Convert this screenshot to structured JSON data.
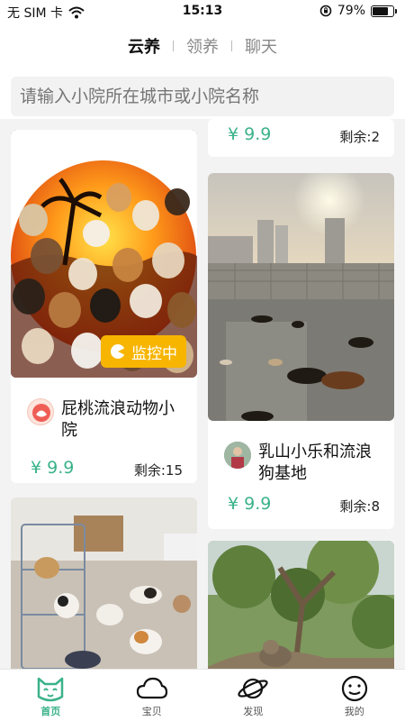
{
  "status_bar": {
    "carrier": "无 SIM 卡",
    "time": "15:13",
    "battery_percent": "79%",
    "battery_level": 0.79
  },
  "top_tabs": [
    {
      "label": "云养",
      "active": true
    },
    {
      "label": "领养",
      "active": false
    },
    {
      "label": "聊天",
      "active": false
    }
  ],
  "search": {
    "placeholder": "请输入小院所在城市或小院名称"
  },
  "cards": [
    {
      "id": "c0",
      "price": "¥ 9.9",
      "remaining": "剩余:2"
    },
    {
      "id": "c1",
      "title": "屁桃流浪动物小院",
      "price": "¥ 9.9",
      "remaining": "剩余:15",
      "badge": "监控中"
    },
    {
      "id": "c2",
      "title": "乳山小乐和流浪狗基地",
      "price": "¥ 9.9",
      "remaining": "剩余:8"
    }
  ],
  "bottom_nav": [
    {
      "label": "首页",
      "icon": "cat-face-icon",
      "active": true
    },
    {
      "label": "宝贝",
      "icon": "cloud-icon",
      "active": false
    },
    {
      "label": "发现",
      "icon": "planet-icon",
      "active": false
    },
    {
      "label": "我的",
      "icon": "smiley-icon",
      "active": false
    }
  ],
  "colors": {
    "accent": "#3bb28b",
    "badge": "#f7b500"
  }
}
